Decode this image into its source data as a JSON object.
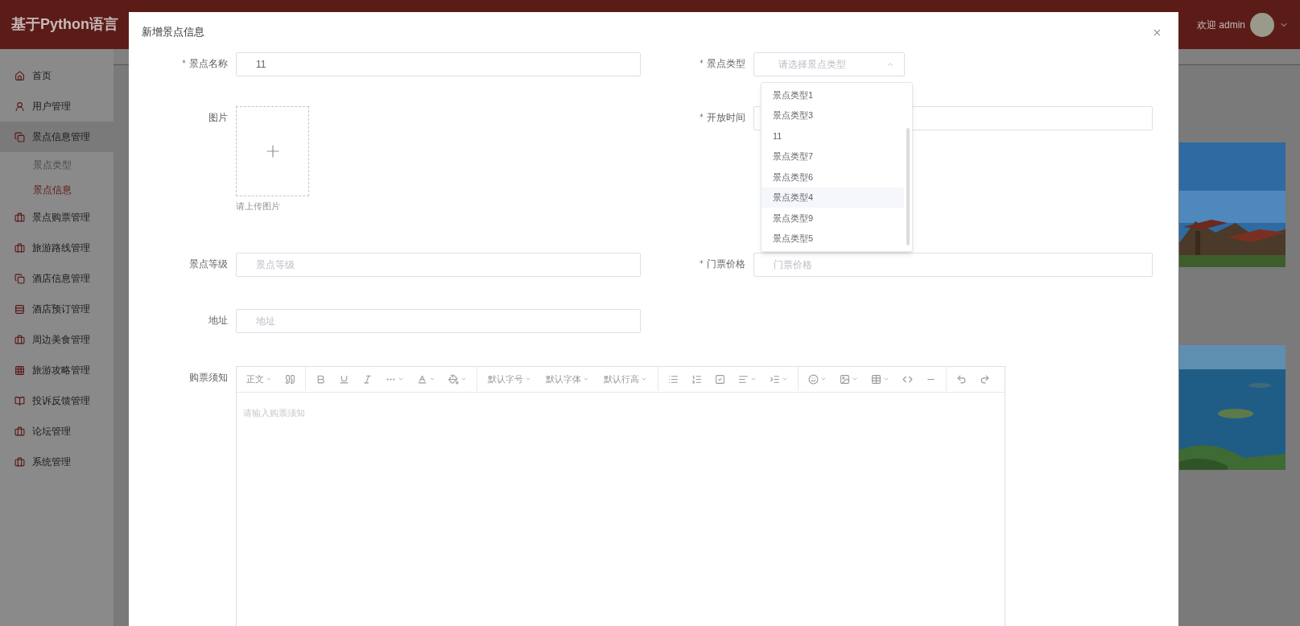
{
  "header": {
    "title": "基于Python语言",
    "welcome": "欢迎 admin"
  },
  "sidebar": {
    "items": [
      {
        "label": "首页",
        "selected": false
      },
      {
        "label": "用户管理",
        "selected": false
      },
      {
        "label": "景点信息管理",
        "selected": true,
        "children": [
          {
            "label": "景点类型",
            "selected": false
          },
          {
            "label": "景点信息",
            "selected": true
          }
        ]
      },
      {
        "label": "景点购票管理",
        "selected": false
      },
      {
        "label": "旅游路线管理",
        "selected": false
      },
      {
        "label": "酒店信息管理",
        "selected": false
      },
      {
        "label": "酒店预订管理",
        "selected": false
      },
      {
        "label": "周边美食管理",
        "selected": false
      },
      {
        "label": "旅游攻略管理",
        "selected": false
      },
      {
        "label": "投诉反馈管理",
        "selected": false
      },
      {
        "label": "论坛管理",
        "selected": false
      },
      {
        "label": "系统管理",
        "selected": false
      }
    ]
  },
  "dialog": {
    "title": "新增景点信息",
    "name": {
      "label": "景点名称",
      "required": true,
      "value": "11"
    },
    "type": {
      "label": "景点类型",
      "required": true,
      "placeholder": "请选择景点类型",
      "open": true,
      "options": [
        {
          "label": "景点类型1",
          "highlighted": false
        },
        {
          "label": "景点类型3",
          "highlighted": false
        },
        {
          "label": "11",
          "highlighted": false
        },
        {
          "label": "景点类型7",
          "highlighted": false
        },
        {
          "label": "景点类型6",
          "highlighted": false
        },
        {
          "label": "景点类型4",
          "highlighted": true
        },
        {
          "label": "景点类型9",
          "highlighted": false
        },
        {
          "label": "景点类型5",
          "highlighted": false
        }
      ]
    },
    "image": {
      "label": "图片",
      "hint": "请上传图片"
    },
    "open_time": {
      "label": "开放时间",
      "required": true
    },
    "level": {
      "label": "景点等级",
      "placeholder": "景点等级"
    },
    "price": {
      "label": "门票价格",
      "required": true,
      "placeholder": "门票价格"
    },
    "address": {
      "label": "地址",
      "placeholder": "地址"
    },
    "notice": {
      "label": "购票须知",
      "placeholder": "请输入购票须知",
      "heading": "正文",
      "dropdowns": [
        "默认字号",
        "默认字体",
        "默认行高"
      ]
    }
  }
}
